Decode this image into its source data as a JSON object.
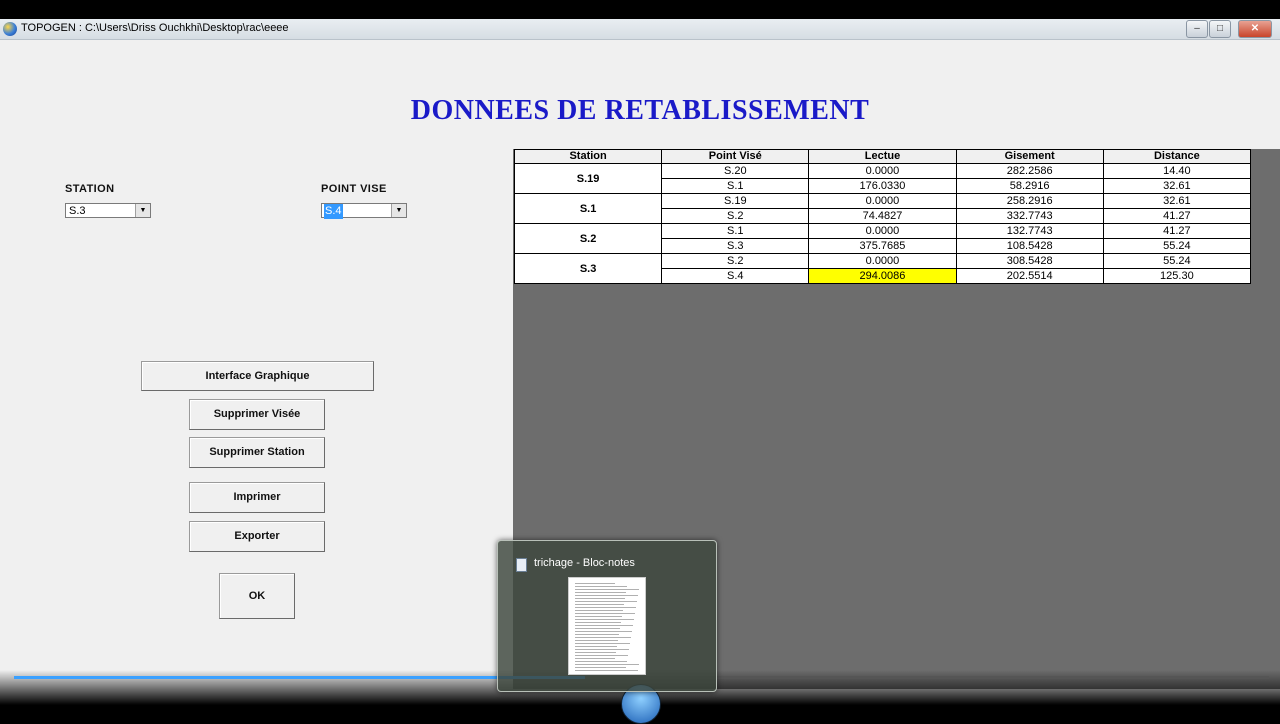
{
  "window": {
    "title": "TOPOGEN : C:\\Users\\Driss Ouchkhi\\Desktop\\rac\\eeee",
    "controls": {
      "minimize": "–",
      "maximize": "□",
      "close": "✕"
    }
  },
  "heading": "DONNEES DE RETABLISSEMENT",
  "form": {
    "station_label": "STATION",
    "station_value": "S.3",
    "point_label": "POINT VISE",
    "point_value": "S.4",
    "dropdown_arrow": "▼"
  },
  "buttons": {
    "interface": "Interface Graphique",
    "delete_sight": "Supprimer Visée",
    "delete_station": "Supprimer Station",
    "print": "Imprimer",
    "export": "Exporter",
    "ok": "OK"
  },
  "table": {
    "headers": [
      "Station",
      "Point Visé",
      "Lectue",
      "Gisement",
      "Distance"
    ],
    "groups": [
      {
        "station": "S.19",
        "rows": [
          {
            "point": "S.20",
            "lecture": "0.0000",
            "gisement": "282.2586",
            "distance": "14.40"
          },
          {
            "point": "S.1",
            "lecture": "176.0330",
            "gisement": "58.2916",
            "distance": "32.61"
          }
        ]
      },
      {
        "station": "S.1",
        "rows": [
          {
            "point": "S.19",
            "lecture": "0.0000",
            "gisement": "258.2916",
            "distance": "32.61"
          },
          {
            "point": "S.2",
            "lecture": "74.4827",
            "gisement": "332.7743",
            "distance": "41.27"
          }
        ]
      },
      {
        "station": "S.2",
        "rows": [
          {
            "point": "S.1",
            "lecture": "0.0000",
            "gisement": "132.7743",
            "distance": "41.27"
          },
          {
            "point": "S.3",
            "lecture": "375.7685",
            "gisement": "108.5428",
            "distance": "55.24"
          }
        ]
      },
      {
        "station": "S.3",
        "rows": [
          {
            "point": "S.2",
            "lecture": "0.0000",
            "gisement": "308.5428",
            "distance": "55.24"
          },
          {
            "point": "S.4",
            "lecture": "294.0086",
            "gisement": "202.5514",
            "distance": "125.30"
          }
        ]
      }
    ],
    "highlight_color": "#ffff00"
  },
  "thumbnail": {
    "title": "trichage - Bloc-notes",
    "icon": "notepad-icon"
  },
  "media": {
    "progress": 0.455,
    "progress_color": "#3aa0ff",
    "play_icon": "pause-icon"
  }
}
